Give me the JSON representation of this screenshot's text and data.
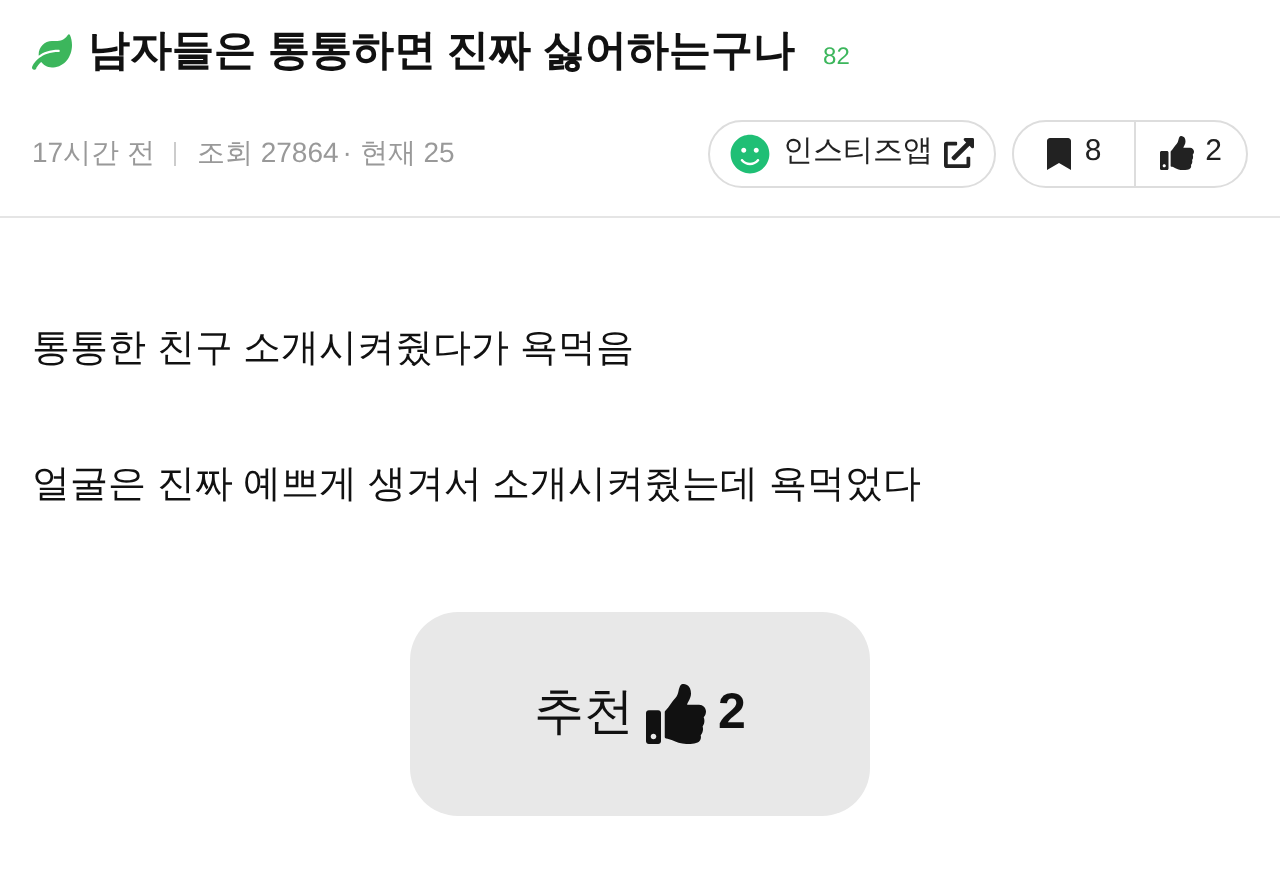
{
  "title": "남자들은 통통하면 진짜 싫어하는구나",
  "comment_count": "82",
  "meta": {
    "time": "17시간 전",
    "views": "조회 27864",
    "current": "· 현재 25"
  },
  "app_button": "인스티즈앱",
  "bookmark_count": "8",
  "like_count": "2",
  "body": [
    "통통한 친구 소개시켜줬다가 욕먹음",
    "얼굴은 진짜 예쁘게 생겨서 소개시켜줬는데 욕먹었다"
  ],
  "recommend": {
    "label": "추천",
    "count": "2"
  }
}
